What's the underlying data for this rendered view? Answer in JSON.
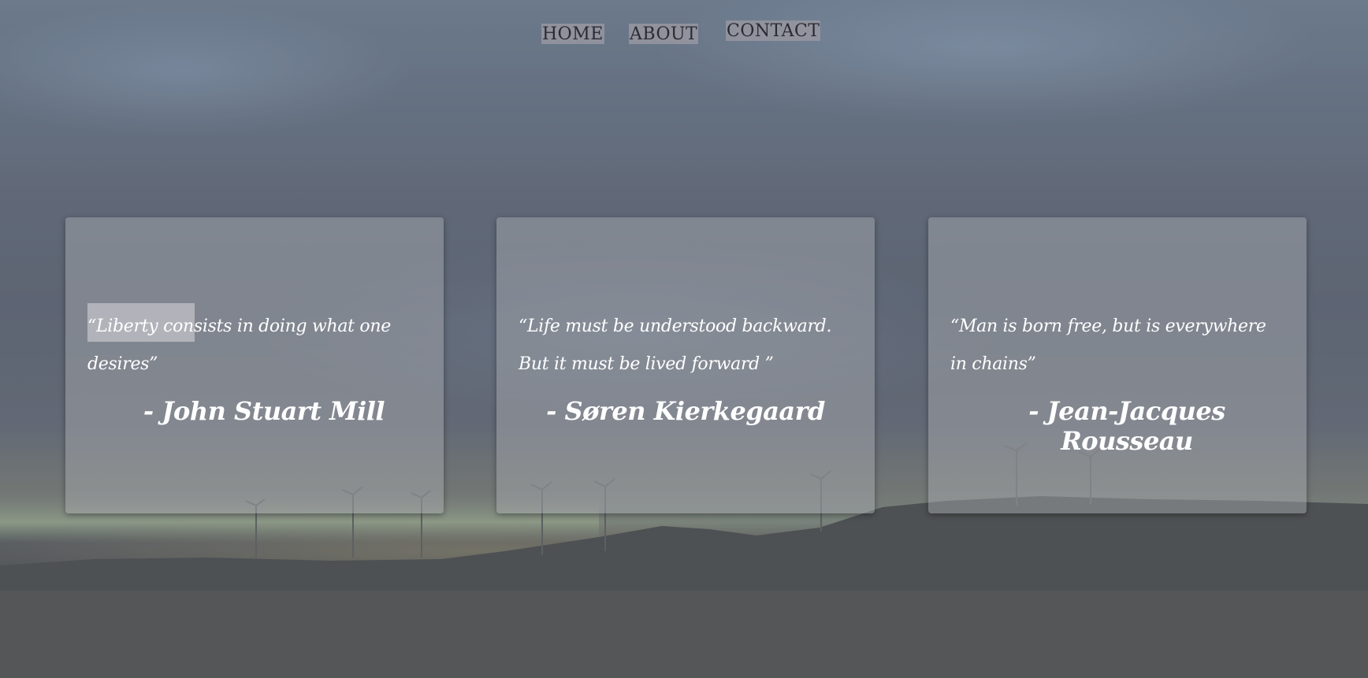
{
  "nav": {
    "home": "HOME",
    "about": "ABOUT",
    "contact": "CONTACT"
  },
  "quotes": [
    {
      "text": "“Liberty consists in doing what one desires”",
      "author": "- John Stuart Mill"
    },
    {
      "text": "“Life must be understood backward. But it must be lived forward ”",
      "author": "- Søren Kierkegaard"
    },
    {
      "text": "“Man is born free, but is everywhere in chains”",
      "author": "- Jean-Jacques Rousseau"
    }
  ],
  "colors": {
    "card_bg": "#aaacb2",
    "text": "#ffffff",
    "nav_bg": "#96969f",
    "nav_text": "#2a2a33"
  }
}
